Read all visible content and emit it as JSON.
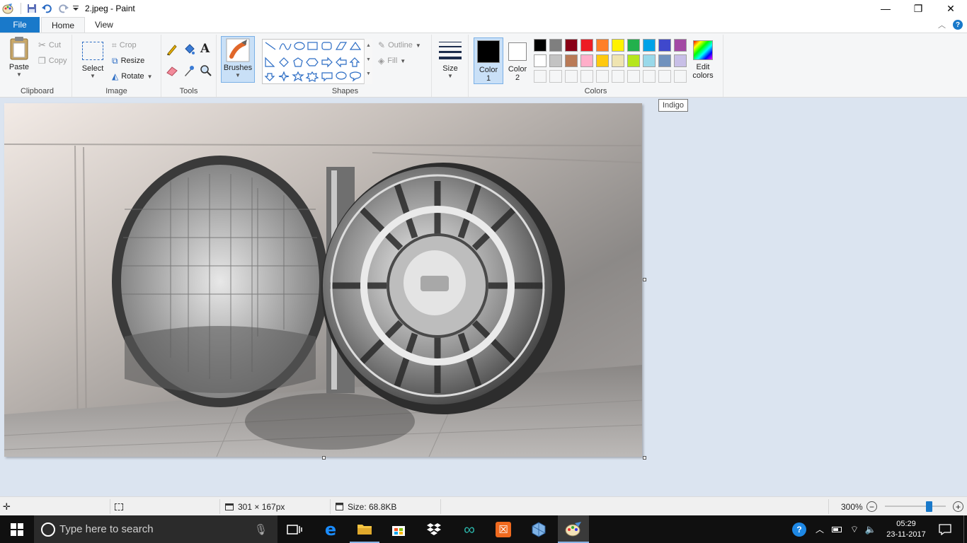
{
  "titlebar": {
    "title": "2.jpeg - Paint",
    "controls": {
      "minimize": "—",
      "maximize": "❐",
      "close": "✕"
    }
  },
  "tabs": {
    "file": "File",
    "home": "Home",
    "view": "View"
  },
  "ribbon": {
    "clipboard": {
      "label": "Clipboard",
      "paste": "Paste",
      "cut": "Cut",
      "copy": "Copy"
    },
    "image": {
      "label": "Image",
      "select": "Select",
      "crop": "Crop",
      "resize": "Resize",
      "rotate": "Rotate"
    },
    "tools": {
      "label": "Tools"
    },
    "brushes": {
      "label": "Brushes"
    },
    "shapes": {
      "label": "Shapes",
      "outline": "Outline",
      "fill": "Fill"
    },
    "size": {
      "label": "Size"
    },
    "colors": {
      "label": "Colors",
      "color1": "Color\n1",
      "color1_line1": "Color",
      "color1_line2": "1",
      "color2_line1": "Color",
      "color2_line2": "2",
      "edit_line1": "Edit",
      "edit_line2": "colors",
      "color1_value": "#000000",
      "color2_value": "#ffffff",
      "palette_row1": [
        "#000000",
        "#7f7f7f",
        "#880015",
        "#ed1c24",
        "#ff7f27",
        "#fff200",
        "#22b14c",
        "#00a2e8",
        "#3f48cc",
        "#a349a4"
      ],
      "palette_row2": [
        "#ffffff",
        "#c3c3c3",
        "#b97a57",
        "#ffaec9",
        "#ffc90e",
        "#efe4b0",
        "#b5e61d",
        "#99d9ea",
        "#7092be",
        "#c8bfe7"
      ],
      "palette_row3": [
        "#f5f6f7",
        "#f5f6f7",
        "#f5f6f7",
        "#f5f6f7",
        "#f5f6f7",
        "#f5f6f7",
        "#f5f6f7",
        "#f5f6f7",
        "#f5f6f7",
        "#f5f6f7"
      ]
    }
  },
  "tooltip": "Indigo",
  "statusbar": {
    "dimensions": "301 × 167px",
    "size": "Size: 68.8KB",
    "zoom": "300%",
    "zoom_level": 0.72
  },
  "taskbar": {
    "search_placeholder": "Type here to search",
    "time": "05:29",
    "date": "23-11-2017"
  }
}
